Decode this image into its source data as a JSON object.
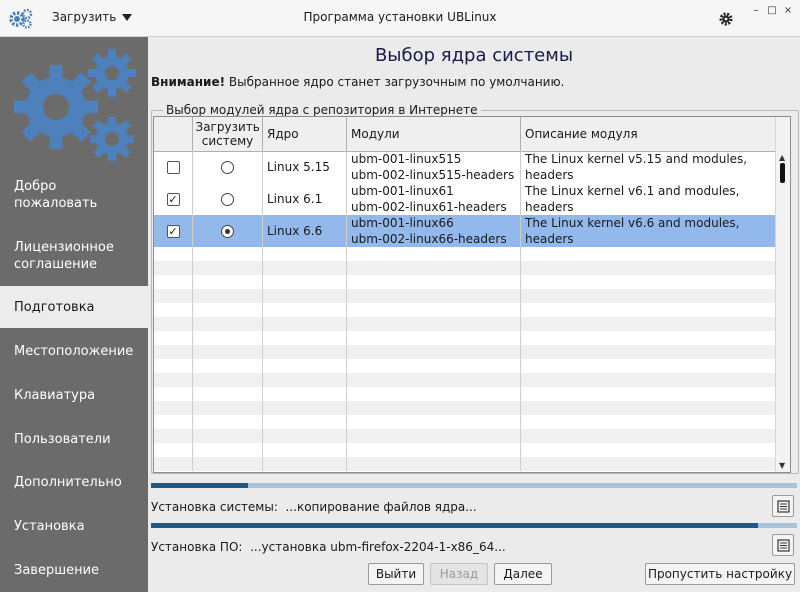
{
  "titlebar": {
    "menu_label": "Загрузить",
    "title": "Программа установки UBLinux",
    "window_buttons": [
      "–",
      "□",
      "×"
    ]
  },
  "sidebar": {
    "items": [
      {
        "label": "Добро пожаловать",
        "active": false
      },
      {
        "label": "Лицензионное соглашение",
        "active": false
      },
      {
        "label": "Подготовка",
        "active": true
      },
      {
        "label": "Местоположение",
        "active": false
      },
      {
        "label": "Клавиатура",
        "active": false
      },
      {
        "label": "Пользователи",
        "active": false
      },
      {
        "label": "Дополнительно",
        "active": false
      },
      {
        "label": "Установка",
        "active": false
      },
      {
        "label": "Завершение",
        "active": false
      }
    ]
  },
  "main": {
    "heading": "Выбор ядра системы",
    "notice_bold": "Внимание!",
    "notice_text": " Выбранное ядро станет загрузочным по умолчанию.",
    "group_title": "Выбор модулей ядра с репозитория в Интернете",
    "table": {
      "headers": [
        "",
        "Загрузить систему",
        "Ядро",
        "Модули",
        "Описание модуля"
      ],
      "rows": [
        {
          "checked": false,
          "boot": false,
          "kernel": "Linux 5.15",
          "modules": [
            "ubm-001-linux515",
            "ubm-002-linux515-headers"
          ],
          "description": [
            "The Linux kernel v5.15 and modules,",
            "headers"
          ],
          "selected": false
        },
        {
          "checked": true,
          "boot": false,
          "kernel": "Linux 6.1",
          "modules": [
            "ubm-001-linux61",
            "ubm-002-linux61-headers"
          ],
          "description": [
            "The Linux kernel v6.1 and modules,",
            "headers"
          ],
          "selected": false
        },
        {
          "checked": true,
          "boot": true,
          "kernel": "Linux 6.6",
          "modules": [
            "ubm-001-linux66",
            "ubm-002-linux66-headers"
          ],
          "description": [
            "The Linux kernel v6.6 and modules,",
            "headers"
          ],
          "selected": true
        }
      ]
    }
  },
  "progress": {
    "system": {
      "label": "Установка системы:",
      "text": "...копирование файлов ядра...",
      "fraction": 0.15
    },
    "software": {
      "label": "Установка ПО:",
      "text": "...установка ubm-firefox-2204-1-x86_64...",
      "fraction": 0.94
    }
  },
  "buttons": {
    "exit": "Выйти",
    "back": "Назад",
    "next": "Далее",
    "skip": "Пропустить настройку"
  },
  "colors": {
    "sidebar_bg": "#6b6b6b",
    "selected_row": "#92b8ec",
    "progress_fill": "#1a5a8e",
    "progress_track": "#a8c3dc",
    "logo_blue": "#4e80bb"
  }
}
